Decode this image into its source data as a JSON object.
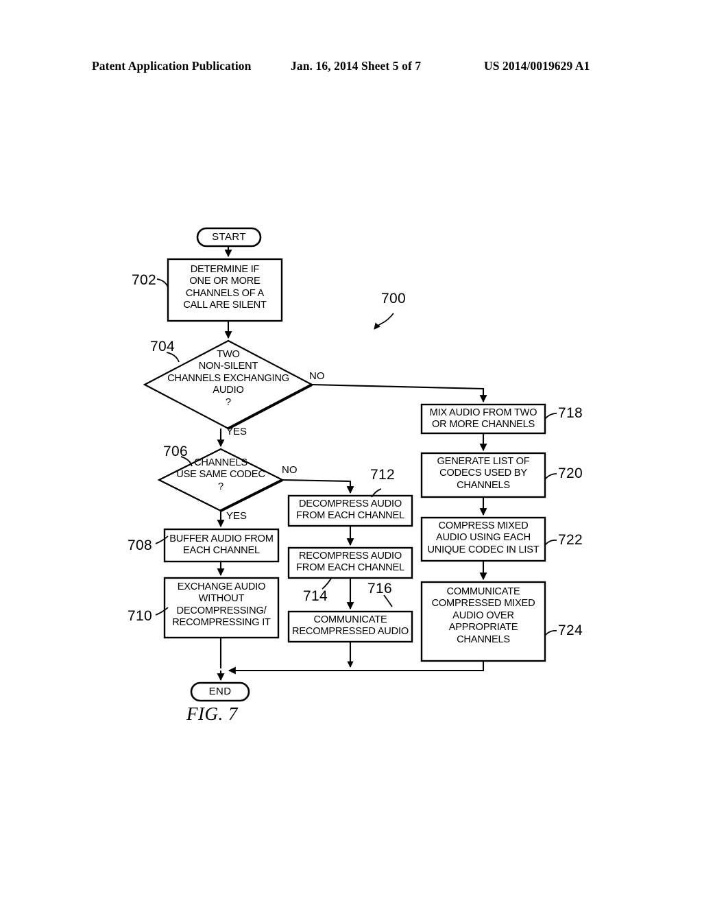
{
  "header": {
    "left": "Patent Application Publication",
    "middle": "Jan. 16, 2014  Sheet 5 of 7",
    "right": "US 2014/0019629 A1"
  },
  "figure": {
    "caption": "FIG. 7",
    "diagram_ref": "700"
  },
  "flowchart": {
    "type": "flowchart",
    "terminators": {
      "start": "START",
      "end": "END"
    },
    "nodes": [
      {
        "ref": "702",
        "shape": "process",
        "text": "DETERMINE IF\nONE OR MORE\nCHANNELS OF A\nCALL ARE SILENT"
      },
      {
        "ref": "704",
        "shape": "decision",
        "text": "TWO\nNON-SILENT\nCHANNELS EXCHANGING\nAUDIO\n?"
      },
      {
        "ref": "706",
        "shape": "decision",
        "text": "CHANNELS\nUSE SAME CODEC\n?"
      },
      {
        "ref": "708",
        "shape": "process",
        "text": "BUFFER AUDIO FROM\nEACH CHANNEL"
      },
      {
        "ref": "710",
        "shape": "process",
        "text": "EXCHANGE AUDIO\nWITHOUT\nDECOMPRESSING/\nRECOMPRESSING IT"
      },
      {
        "ref": "712",
        "shape": "process",
        "text": "DECOMPRESS AUDIO\nFROM EACH CHANNEL"
      },
      {
        "ref": "714",
        "shape": "process",
        "text": "RECOMPRESS AUDIO\nFROM EACH CHANNEL"
      },
      {
        "ref": "716",
        "shape": "process",
        "text": "COMMUNICATE\nRECOMPRESSED AUDIO"
      },
      {
        "ref": "718",
        "shape": "process",
        "text": "MIX AUDIO FROM TWO\nOR MORE CHANNELS"
      },
      {
        "ref": "720",
        "shape": "process",
        "text": "GENERATE LIST OF\nCODECS USED BY\nCHANNELS"
      },
      {
        "ref": "722",
        "shape": "process",
        "text": "COMPRESS MIXED\nAUDIO USING EACH\nUNIQUE CODEC IN LIST"
      },
      {
        "ref": "724",
        "shape": "process",
        "text": "COMMUNICATE\nCOMPRESSED MIXED\nAUDIO OVER\nAPPROPRIATE\nCHANNELS"
      }
    ],
    "branch_labels": {
      "d704_no": "NO",
      "d704_yes": "YES",
      "d706_no": "NO",
      "d706_yes": "YES"
    },
    "colors": {
      "ink": "#000000",
      "paper": "#ffffff"
    }
  }
}
